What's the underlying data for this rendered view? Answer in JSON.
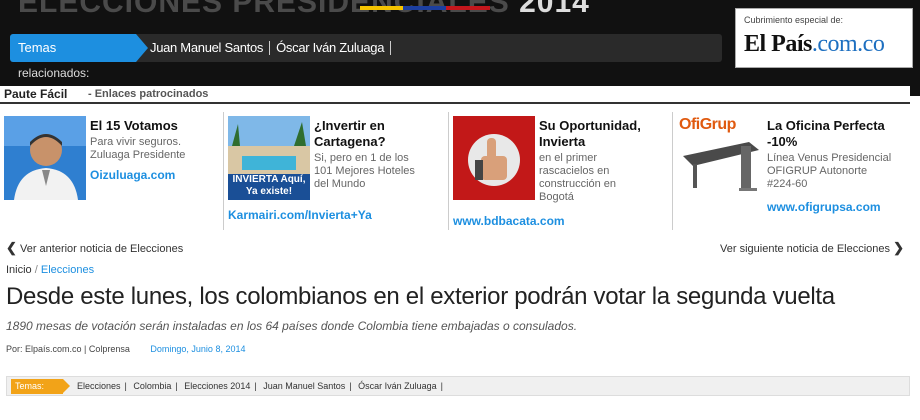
{
  "header": {
    "banner_title": "ELECCIONES PRESIDENCIALES",
    "banner_year": "2014",
    "nav_tab": "Temas",
    "nav_links": [
      "Juan Manuel Santos",
      "Óscar Iván Zuluaga"
    ],
    "relacionados": "relacionados:",
    "sponsor_label": "Cubrimiento especial de:",
    "sponsor_logo_main": "El País",
    "sponsor_logo_com": ".com.co"
  },
  "paute": {
    "title": "Paute Fácil",
    "subtitle": "- Enlaces patrocinados"
  },
  "ads": [
    {
      "title": "El 15 Votamos",
      "desc": "Para vivir seguros. Zuluaga Presidente",
      "link": "Oizuluaga.com"
    },
    {
      "title": "¿Invertir en Cartagena?",
      "desc": "Si, pero en 1 de los 101 Mejores Hoteles del Mundo",
      "link": "Karmairi.com/Invierta+Ya",
      "img_text": "INVIERTA Aquí, Ya existe!"
    },
    {
      "title": "Su Oportunidad, Invierta",
      "desc": "en el primer rascacielos en construcción en Bogotá",
      "link": "www.bdbacata.com"
    },
    {
      "title": "La Oficina Perfecta -10%",
      "desc": "Línea Venus Presidencial OFIGRUP Autonorte #224-60",
      "link": "www.ofigrupsa.com",
      "img_logo": "OfiGrup"
    }
  ],
  "nav_arrows": {
    "prev": "Ver anterior noticia de Elecciones",
    "next": "Ver siguiente noticia de Elecciones"
  },
  "breadcrumb": {
    "home": "Inicio",
    "separator": "/",
    "current": "Elecciones"
  },
  "article": {
    "headline": "Desde este lunes, los colombianos en el exterior podrán votar la segunda vuelta",
    "subhead": "1890 mesas de votación serán instaladas en los 64 países donde Colombia tiene embajadas o consulados.",
    "byline": "Por: Elpaís.com.co | Colprensa",
    "date": "Domingo, Junio 8, 2014"
  },
  "tags": {
    "label": "Temas:",
    "items": [
      "Elecciones",
      "Colombia",
      "Elecciones 2014",
      "Juan Manuel Santos",
      "Óscar Iván Zuluaga"
    ]
  },
  "colors": {
    "accent_blue": "#1d8fe0",
    "tag_orange": "#f2a318",
    "header_black": "#111111"
  }
}
